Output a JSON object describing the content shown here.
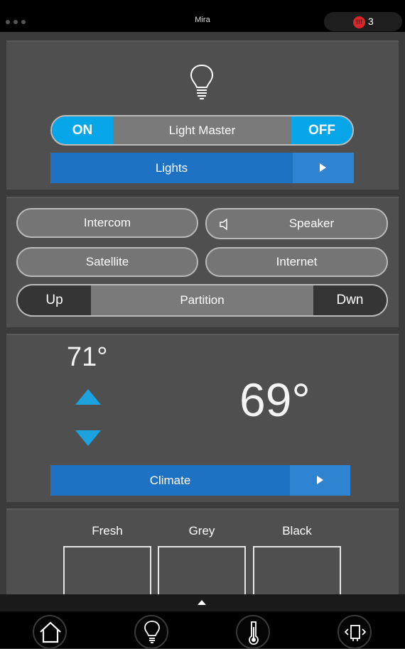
{
  "statusbar": {
    "title": "Mira",
    "alert_count": "3",
    "alert_icon": "alert-icon"
  },
  "lighting": {
    "icon": "lightbulb-icon",
    "master_on": "ON",
    "master_label": "Light Master",
    "master_off": "OFF",
    "nav_label": "Lights"
  },
  "av": {
    "intercom": "Intercom",
    "speaker": "Speaker",
    "satellite": "Satellite",
    "internet": "Internet",
    "partition_up": "Up",
    "partition_label": "Partition",
    "partition_down": "Dwn"
  },
  "climate": {
    "setpoint": "71°",
    "current": "69°",
    "nav_label": "Climate"
  },
  "switches": {
    "fresh": "Fresh",
    "grey": "Grey",
    "black": "Black"
  },
  "footer": {
    "items": [
      "home-icon",
      "lightbulb-icon",
      "thermometer-icon",
      "vibration-icon"
    ]
  },
  "colors": {
    "accent_blue": "#06a6e8",
    "nav_blue": "#1d72c4",
    "alert_red": "#d9262b"
  }
}
